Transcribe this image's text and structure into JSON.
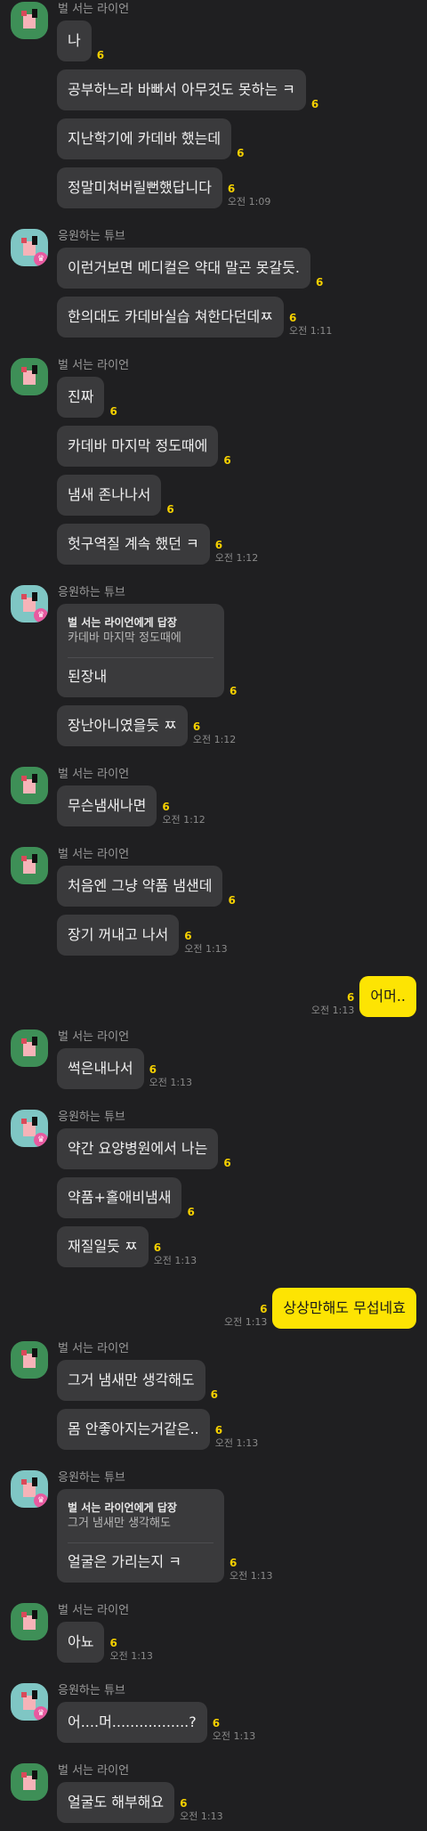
{
  "users": {
    "lion": "벌 서는 라이언",
    "tube": "응원하는 튜브"
  },
  "groups": [
    {
      "who": "lion",
      "msgs": [
        {
          "text": "나",
          "count": "6"
        },
        {
          "text": "공부하느라 바빠서 아무것도 못하는 ㅋ",
          "count": "6"
        },
        {
          "text": "지난학기에 카데바 했는데",
          "count": "6"
        },
        {
          "text": "정말미쳐버릴뻔했답니다",
          "count": "6",
          "time": "오전 1:09"
        }
      ]
    },
    {
      "who": "tube",
      "msgs": [
        {
          "text": "이런거보면 메디컬은 약대 말곤 못갈듯.",
          "count": "6"
        },
        {
          "text": "한의대도 카데바실습 쳐한다던데ㅉ",
          "count": "6",
          "time": "오전 1:11"
        }
      ]
    },
    {
      "who": "lion",
      "msgs": [
        {
          "text": "진짜",
          "count": "6"
        },
        {
          "text": "카데바 마지막 정도때에",
          "count": "6"
        },
        {
          "text": "냄새 존나나서",
          "count": "6"
        },
        {
          "text": "헛구역질 계속 했던 ㅋ",
          "count": "6",
          "time": "오전 1:12"
        }
      ]
    },
    {
      "who": "tube",
      "msgs": [
        {
          "reply_head": "벌 서는 라이언에게 답장",
          "reply_quote": "카데바 마지막 정도때에",
          "text": "된장내",
          "count": "6"
        },
        {
          "text": "장난아니였을듯 ㅉ",
          "count": "6",
          "time": "오전 1:12"
        }
      ]
    },
    {
      "who": "lion",
      "msgs": [
        {
          "text": "무슨냄새나면",
          "count": "6",
          "time": "오전 1:12"
        }
      ]
    },
    {
      "who": "lion",
      "msgs": [
        {
          "text": "처음엔 그냥 약품 냄샌데",
          "count": "6"
        },
        {
          "text": "장기 꺼내고 나서",
          "count": "6",
          "time": "오전 1:13"
        }
      ]
    },
    {
      "mine": true,
      "text": "어머..",
      "count": "6",
      "time": "오전 1:13"
    },
    {
      "who": "lion",
      "msgs": [
        {
          "text": "썩은내나서",
          "count": "6",
          "time": "오전 1:13"
        }
      ]
    },
    {
      "who": "tube",
      "msgs": [
        {
          "text": "약간 요양병원에서 나는",
          "count": "6"
        },
        {
          "text": "약품+홀애비냄새",
          "count": "6"
        },
        {
          "text": "재질일듯 ㅉ",
          "count": "6",
          "time": "오전 1:13"
        }
      ]
    },
    {
      "mine": true,
      "text": "상상만해도 무섭네효",
      "count": "6",
      "time": "오전 1:13"
    },
    {
      "who": "lion",
      "msgs": [
        {
          "text": "그거 냄새만 생각해도",
          "count": "6"
        },
        {
          "text": "몸 안좋아지는거같은..",
          "count": "6",
          "time": "오전 1:13"
        }
      ]
    },
    {
      "who": "tube",
      "msgs": [
        {
          "reply_head": "벌 서는 라이언에게 답장",
          "reply_quote": "그거 냄새만 생각해도",
          "text": "얼굴은 가리는지 ㅋ",
          "count": "6",
          "time": "오전 1:13"
        }
      ]
    },
    {
      "who": "lion",
      "msgs": [
        {
          "text": "아뇨",
          "count": "6",
          "time": "오전 1:13"
        }
      ]
    },
    {
      "who": "tube",
      "msgs": [
        {
          "text": "어....머.................?",
          "count": "6",
          "time": "오전 1:13"
        }
      ]
    },
    {
      "who": "lion",
      "msgs": [
        {
          "text": "얼굴도 해부해요",
          "count": "6",
          "time": "오전 1:13"
        }
      ]
    }
  ]
}
